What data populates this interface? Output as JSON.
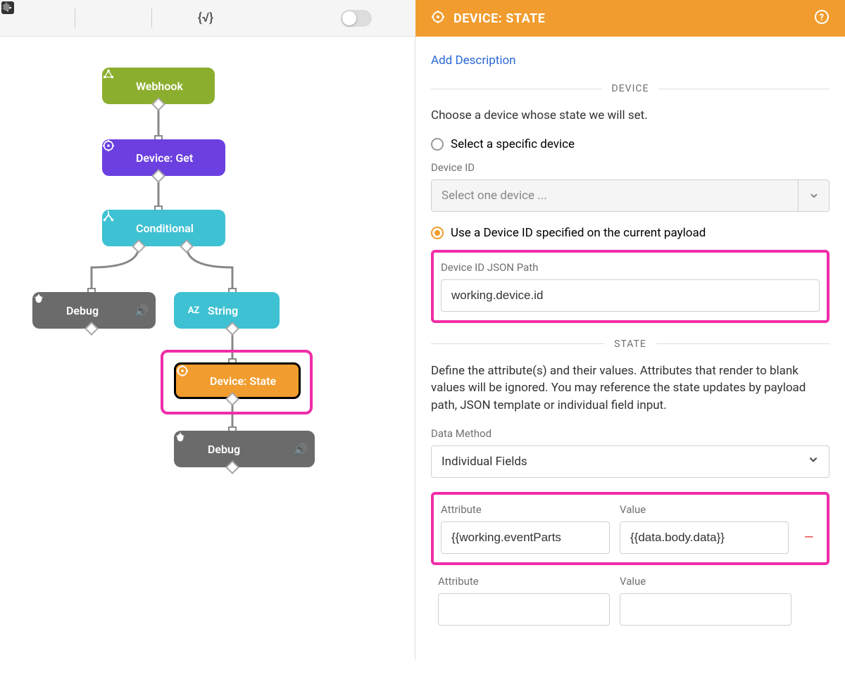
{
  "panel": {
    "title": "DEVICE: STATE",
    "addDescription": "Add Description",
    "sections": {
      "device": {
        "heading": "DEVICE",
        "instruction": "Choose a device whose state we will set.",
        "radioSpecific": "Select a specific device",
        "deviceIdLabel": "Device ID",
        "deviceIdPlaceholder": "Select one device ...",
        "radioPayload": "Use a Device ID specified on the current payload",
        "jsonPathLabel": "Device ID JSON Path",
        "jsonPathValue": "working.device.id"
      },
      "state": {
        "heading": "STATE",
        "instruction": "Define the attribute(s) and their values. Attributes that render to blank values will be ignored. You may reference the state updates by payload path, JSON template or individual field input.",
        "dataMethodLabel": "Data Method",
        "dataMethodValue": "Individual Fields",
        "rows": [
          {
            "attrLabel": "Attribute",
            "valLabel": "Value",
            "attr": "{{working.eventParts",
            "val": "{{data.body.data}}"
          },
          {
            "attrLabel": "Attribute",
            "valLabel": "Value",
            "attr": "",
            "val": ""
          }
        ]
      }
    }
  },
  "nodes": {
    "webhook": "Webhook",
    "deviceGet": "Device: Get",
    "conditional": "Conditional",
    "debug1": "Debug",
    "string": "String",
    "deviceState": "Device: State",
    "debug2": "Debug"
  }
}
